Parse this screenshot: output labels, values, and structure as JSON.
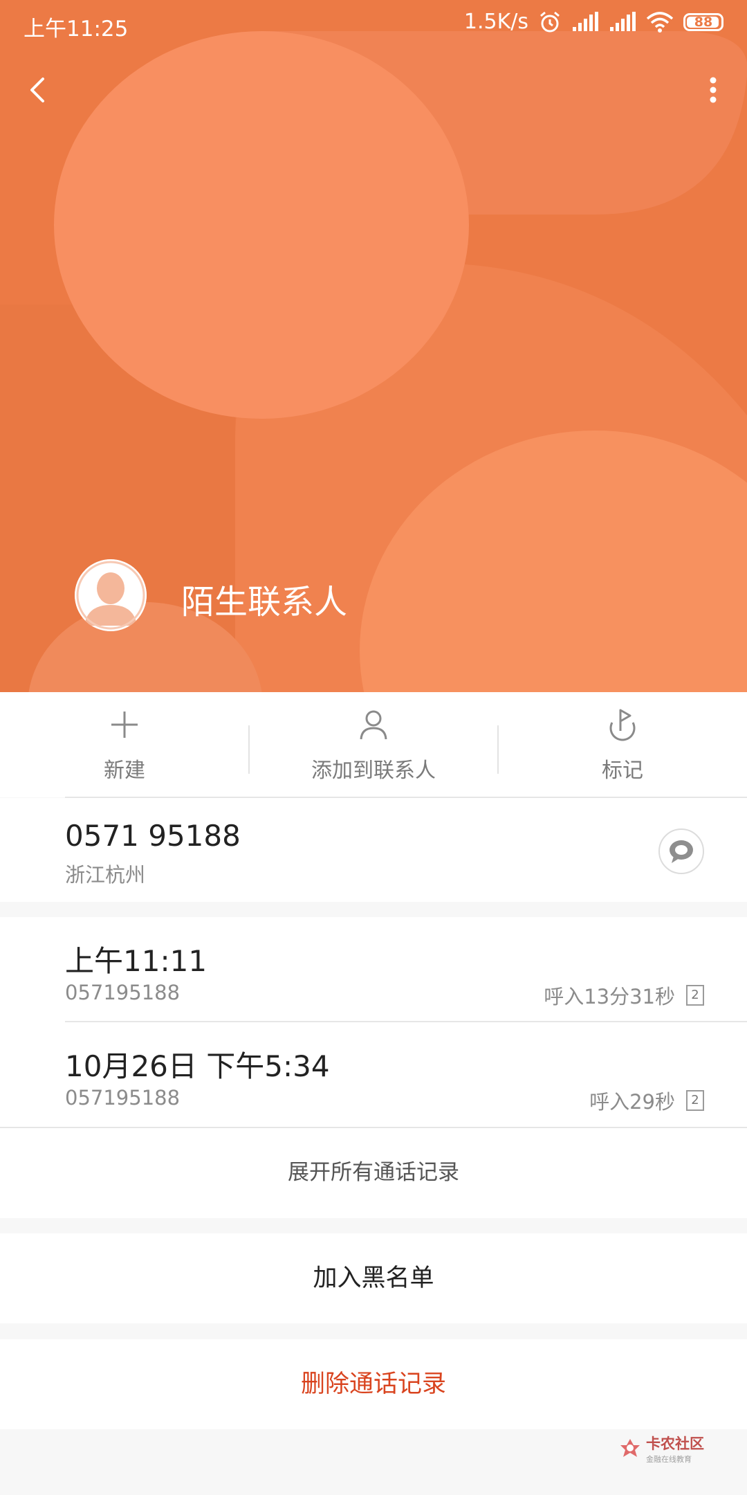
{
  "status_bar": {
    "time": "上午11:25",
    "speed": "1.5K/s",
    "battery": "88"
  },
  "contact": {
    "name": "陌生联系人"
  },
  "actions": [
    {
      "label": "新建",
      "icon": "plus-icon"
    },
    {
      "label": "添加到联系人",
      "icon": "person-icon"
    },
    {
      "label": "标记",
      "icon": "flag-icon"
    }
  ],
  "phone": {
    "number": "0571 95188",
    "location": "浙江杭州"
  },
  "calls": [
    {
      "time": "上午11:11",
      "number": "057195188",
      "detail": "呼入13分31秒",
      "sim": "2"
    },
    {
      "time": "10月26日 下午5:34",
      "number": "057195188",
      "detail": "呼入29秒",
      "sim": "2"
    }
  ],
  "expand_label": "展开所有通话记录",
  "blacklist_label": "加入黑名单",
  "delete_label": "删除通话记录",
  "watermark": {
    "title": "卡农社区",
    "subtitle": "金融在线教育"
  },
  "colors": {
    "header": "#ec7a45",
    "delete": "#d9441f"
  }
}
